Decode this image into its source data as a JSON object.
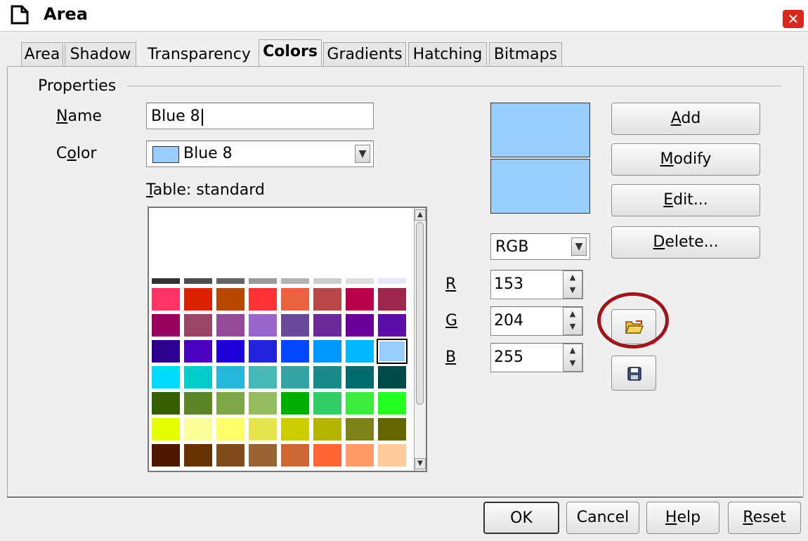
{
  "window": {
    "title": "Area",
    "close_label": "✕"
  },
  "tabs": [
    {
      "label": "Area"
    },
    {
      "label": "Shadow"
    },
    {
      "label": "Transparency"
    },
    {
      "label": "Colors"
    },
    {
      "label": "Gradients"
    },
    {
      "label": "Hatching"
    },
    {
      "label": "Bitmaps"
    }
  ],
  "active_tab": "Colors",
  "properties": {
    "group_label": "Properties",
    "name_label_pre": "",
    "name_label_mn": "N",
    "name_label_post": "ame",
    "name_value": "Blue 8",
    "color_label_pre": "C",
    "color_label_mn": "o",
    "color_label_post": "lor",
    "color_value": "Blue 8",
    "color_swatch": "#99ccff",
    "table_label_mn": "T",
    "table_label_post": "able: standard"
  },
  "color_model": {
    "value": "RGB"
  },
  "rgb": {
    "r_label": "R",
    "r_value": "153",
    "g_label": "G",
    "g_value": "204",
    "b_label": "B",
    "b_value": "255"
  },
  "buttons": {
    "add_mn": "A",
    "add_post": "dd",
    "modify_mn": "M",
    "modify_post": "odify",
    "edit_mn": "E",
    "edit_post": "dit...",
    "delete_mn": "D",
    "delete_post": "elete...",
    "ok": "OK",
    "cancel": "Cancel",
    "help_mn": "H",
    "help_post": "elp",
    "reset_mn": "R",
    "reset_post": "eset"
  },
  "icons": {
    "load_table": "open-folder-icon",
    "save_table": "save-floppy-icon",
    "highlight_circle_color": "#a0141c"
  },
  "palette": {
    "selected": "#99ccff",
    "partial_row": [
      "#333333",
      "#4d4d4d",
      "#666666",
      "#999999",
      "#b3b3b3",
      "#cccccc",
      "#dddddd",
      "#e6e6ff"
    ],
    "rows": [
      [
        "#ff3366",
        "#dc2300",
        "#b84700",
        "#ff3333",
        "#eb613d",
        "#b84747",
        "#b8004d",
        "#9e2550"
      ],
      [
        "#99005f",
        "#9a4566",
        "#964a9a",
        "#9966cc",
        "#6a4a9a",
        "#6a2a9a",
        "#6a009a",
        "#5c0fa8"
      ],
      [
        "#2d0091",
        "#4b00c0",
        "#1e00db",
        "#2323dc",
        "#0047ff",
        "#0099ff",
        "#00b8ff",
        "#99ccff"
      ],
      [
        "#00dcff",
        "#00cccc",
        "#23b8dc",
        "#47b8b8",
        "#33a3a3",
        "#198a8a",
        "#006b6b",
        "#004a4a"
      ],
      [
        "#355e00",
        "#5c8526",
        "#7da647",
        "#94bd5e",
        "#00ae00",
        "#33cc66",
        "#3deb3d",
        "#23ff23"
      ],
      [
        "#e6ff00",
        "#ffff99",
        "#ffff66",
        "#e6e64c",
        "#cccc00",
        "#b3b300",
        "#808019",
        "#666600"
      ],
      [
        "#4c1900",
        "#663300",
        "#804c19",
        "#996633",
        "#cc6633",
        "#ff6633",
        "#ff9966",
        "#ffcc99"
      ]
    ]
  }
}
